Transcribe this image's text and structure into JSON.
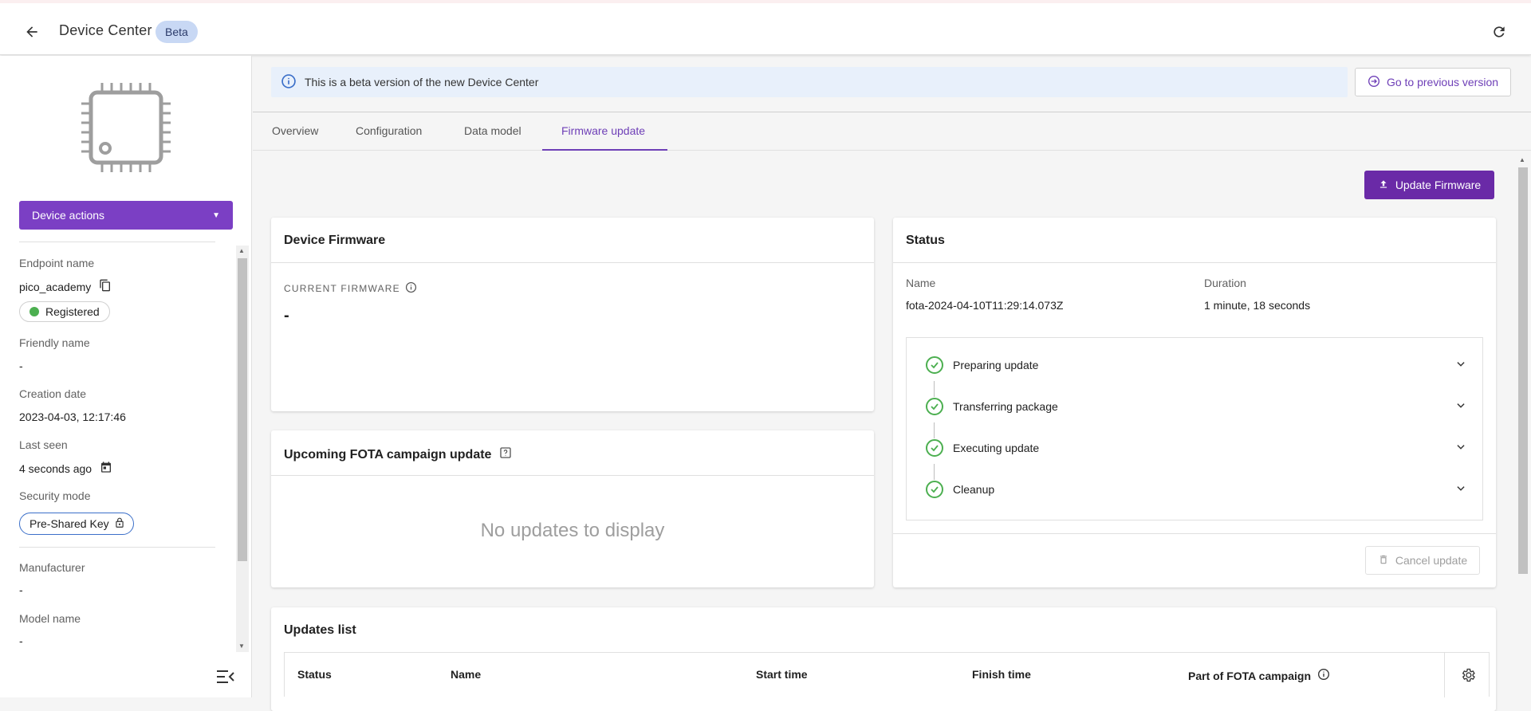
{
  "header": {
    "title": "Device Center",
    "beta_badge": "Beta"
  },
  "sidebar": {
    "device_actions_label": "Device actions",
    "fields": {
      "endpoint_label": "Endpoint name",
      "endpoint_value": "pico_academy",
      "registration_status": "Registered",
      "friendly_label": "Friendly name",
      "friendly_value": "-",
      "creation_label": "Creation date",
      "creation_value": "2023-04-03, 12:17:46",
      "last_seen_label": "Last seen",
      "last_seen_value": "4 seconds ago",
      "security_label": "Security mode",
      "security_value": "Pre-Shared Key",
      "manufacturer_label": "Manufacturer",
      "manufacturer_value": "-",
      "model_label": "Model name",
      "model_value": "-"
    }
  },
  "banner": {
    "text": "This is a beta version of the new Device Center",
    "prev_version_label": "Go to previous version"
  },
  "tabs": [
    {
      "label": "Overview"
    },
    {
      "label": "Configuration"
    },
    {
      "label": "Data model"
    },
    {
      "label": "Firmware update"
    }
  ],
  "active_tab": "Firmware update",
  "update_firmware_label": "Update Firmware",
  "device_firmware": {
    "title": "Device Firmware",
    "current_label": "CURRENT FIRMWARE",
    "current_value": "-"
  },
  "upcoming": {
    "title": "Upcoming FOTA campaign update",
    "empty_text": "No updates to display"
  },
  "status": {
    "title": "Status",
    "name_label": "Name",
    "name_value": "fota-2024-04-10T11:29:14.073Z",
    "duration_label": "Duration",
    "duration_value": "1 minute, 18 seconds",
    "steps": [
      {
        "label": "Preparing update"
      },
      {
        "label": "Transferring package"
      },
      {
        "label": "Executing update"
      },
      {
        "label": "Cleanup"
      }
    ],
    "cancel_label": "Cancel update"
  },
  "updates_list": {
    "title": "Updates list",
    "columns": [
      "Status",
      "Name",
      "Start time",
      "Finish time",
      "Part of FOTA campaign"
    ]
  },
  "colors": {
    "primary": "#7b3fc4",
    "success": "#4caf50",
    "info_bg": "#e8f0fb"
  }
}
